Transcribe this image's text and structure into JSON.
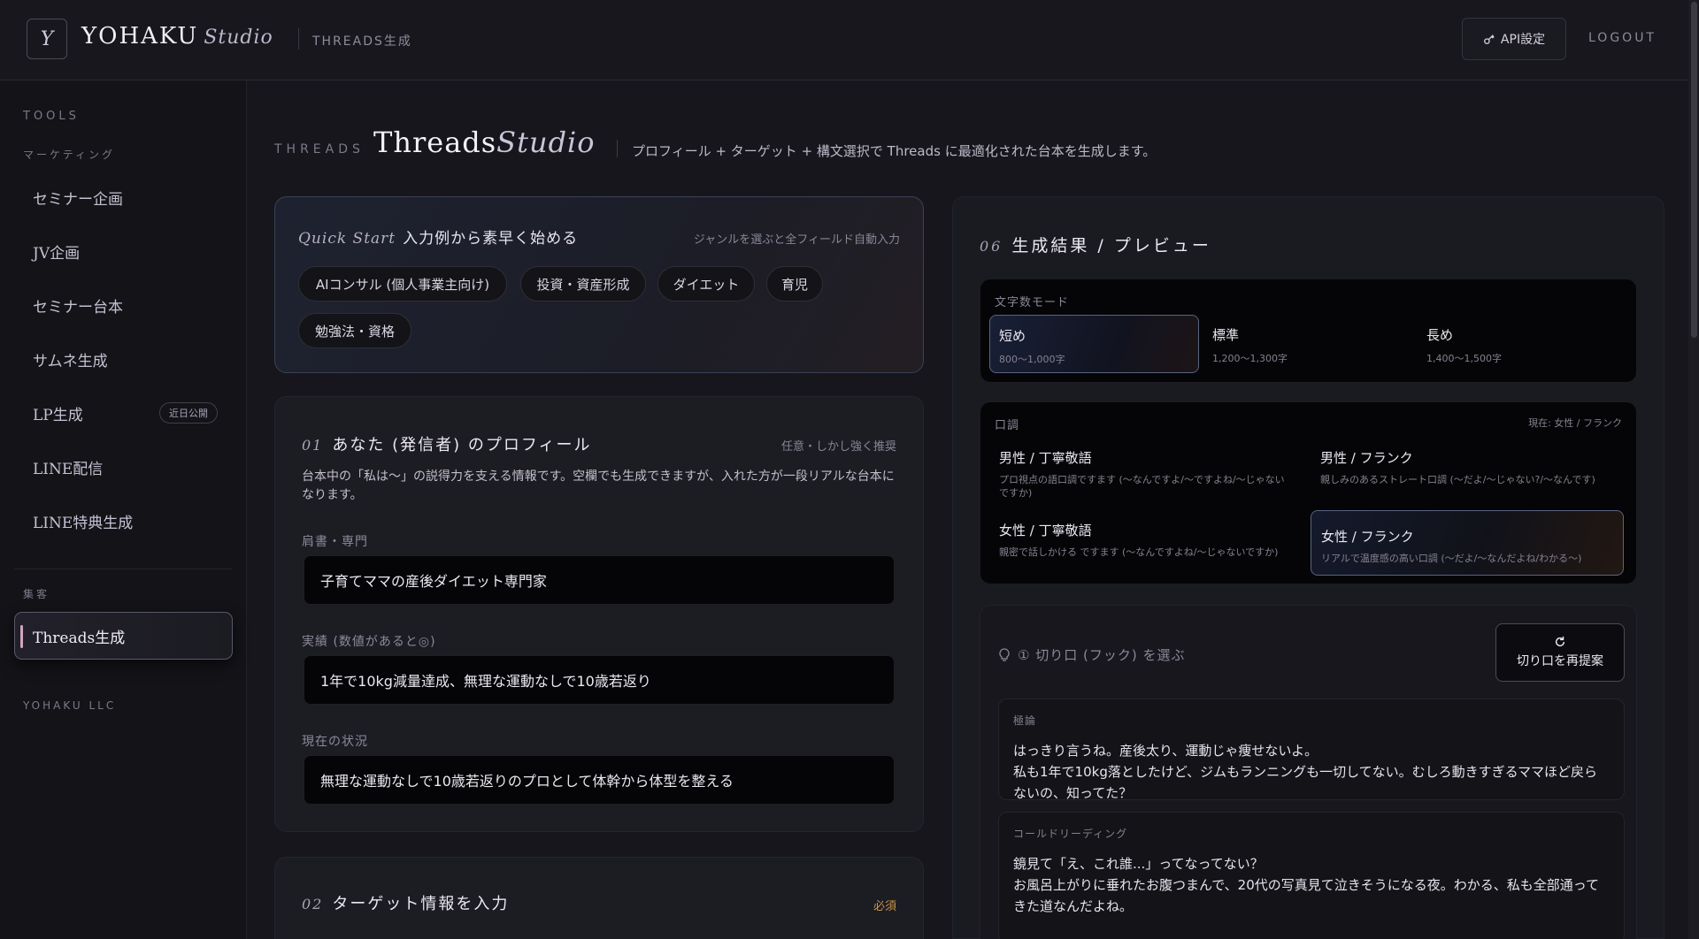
{
  "header": {
    "logo_letter": "Y",
    "brand": "YOHAKU",
    "brand_sub": "Studio",
    "crumb": "THREADS生成",
    "api_label": "API設定",
    "logout_label": "LOGOUT"
  },
  "sidebar": {
    "tools_label": "TOOLS",
    "marketing_label": "マーケティング",
    "items": [
      {
        "label": "セミナー企画"
      },
      {
        "label": "JV企画"
      },
      {
        "label": "セミナー台本"
      },
      {
        "label": "サムネ生成"
      },
      {
        "label": "LP生成",
        "badge": "近日公開"
      },
      {
        "label": "LINE配信"
      },
      {
        "label": "LINE特典生成"
      }
    ],
    "acq_label": "集客",
    "active_item": "Threads生成",
    "footer": "YOHAKU LLC"
  },
  "page": {
    "kicker": "THREADS",
    "title_main": "Threads",
    "title_italic": "Studio",
    "description": "プロフィール + ターゲット + 構文選択で Threads に最適化された台本を生成します。"
  },
  "quick_start": {
    "title_italic": "Quick Start",
    "title": "入力例から素早く始める",
    "hint": "ジャンルを選ぶと全フィールド自動入力",
    "chips": [
      "AIコンサル (個人事業主向け)",
      "投資・資産形成",
      "ダイエット",
      "育児",
      "勉強法・資格"
    ]
  },
  "profile": {
    "num": "01",
    "title": "あなた (発信者) のプロフィール",
    "note": "任意・しかし強く推奨",
    "description": "台本中の「私は〜」の説得力を支える情報です。空欄でも生成できますが、入れた方が一段リアルな台本になります。",
    "fields": [
      {
        "label": "肩書・専門",
        "value": "子育てママの産後ダイエット専門家"
      },
      {
        "label": "実績 (数値があると◎)",
        "value": "1年で10kg減量達成、無理な運動なしで10歳若返り"
      },
      {
        "label": "現在の状況",
        "value": "無理な運動なしで10歳若返りのプロとして体幹から体型を整える"
      }
    ]
  },
  "target": {
    "num": "02",
    "title": "ターゲット情報を入力",
    "required": "必須"
  },
  "result": {
    "num": "06",
    "title": "生成結果 / プレビュー",
    "mode_label": "文字数モード",
    "modes": [
      {
        "title": "短め",
        "sub": "800〜1,000字",
        "selected": true
      },
      {
        "title": "標準",
        "sub": "1,200〜1,300字",
        "selected": false
      },
      {
        "title": "長め",
        "sub": "1,400〜1,500字",
        "selected": false
      }
    ],
    "tone_label": "口調",
    "tone_current": "現在: 女性 / フランク",
    "tones": [
      {
        "title": "男性 / 丁寧敬語",
        "sub": "プロ視点の語口調ですます (〜なんですよ/〜ですよね/〜じゃないですか)",
        "selected": false
      },
      {
        "title": "男性 / フランク",
        "sub": "親しみのあるストレート口調 (〜だよ/〜じゃない?/〜なんです)",
        "selected": false
      },
      {
        "title": "女性 / 丁寧敬語",
        "sub": "親密で話しかける ですます (〜なんですよね/〜じゃないですか)",
        "selected": false
      },
      {
        "title": "女性 / フランク",
        "sub": "リアルで温度感の高い口調 (〜だよ/〜なんだよね/わかる〜)",
        "selected": true
      }
    ],
    "hook_title": "① 切り口 (フック) を選ぶ",
    "repropose_label": "切り口を再提案",
    "hooks": [
      {
        "type": "極論",
        "text": "はっきり言うね。産後太り、運動じゃ痩せないよ。\n私も1年で10kg落としたけど、ジムもランニングも一切してない。むしろ動きすぎるママほど戻らないの、知ってた？"
      },
      {
        "type": "コールドリーディング",
        "text": "鏡見て「え、これ誰...」ってなってない？\nお風呂上がりに垂れたお腹つまんで、20代の写真見て泣きそうになる夜。わかる、私も全部通ってきた道なんだよね。"
      }
    ]
  }
}
